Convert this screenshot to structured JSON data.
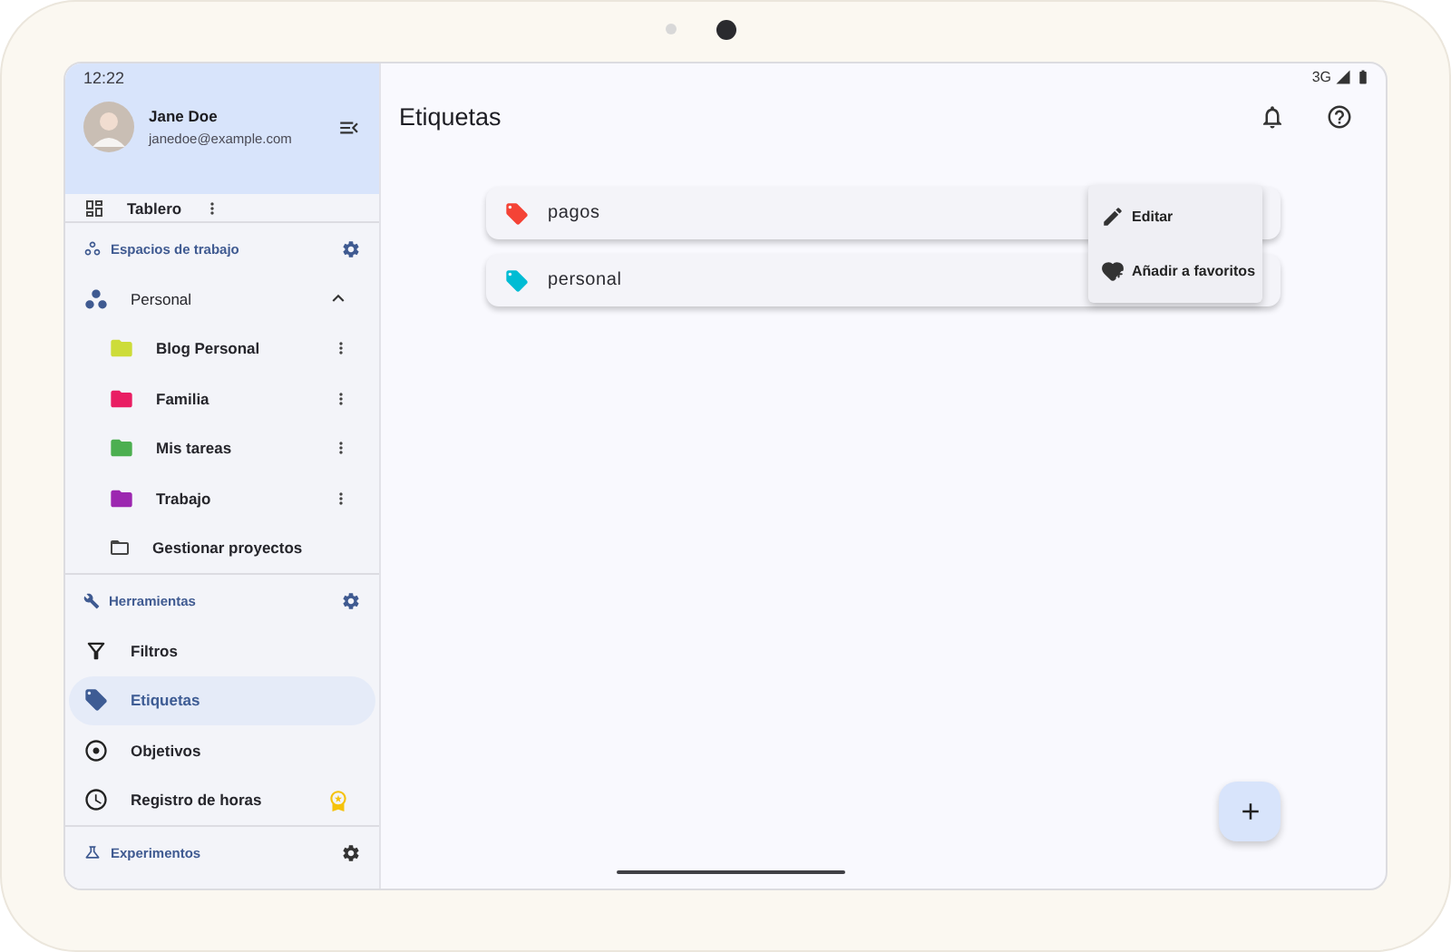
{
  "status_bar": {
    "time": "12:22",
    "network": "3G"
  },
  "profile": {
    "name": "Jane Doe",
    "email": "janedoe@example.com"
  },
  "sidebar": {
    "partial_item": {
      "label": "Tablero"
    },
    "workspaces": {
      "title": "Espacios de trabajo",
      "group": {
        "label": "Personal",
        "expanded": true,
        "children": [
          {
            "label": "Blog Personal",
            "kind": "project",
            "color": "#cddc39"
          },
          {
            "label": "Familia",
            "kind": "project",
            "color": "#e91e63"
          },
          {
            "label": "Mis tareas",
            "kind": "project",
            "color": "#4caf50"
          },
          {
            "label": "Trabajo",
            "kind": "project",
            "color": "#9c27b0"
          },
          {
            "label": "Gestionar proyectos",
            "kind": "manage"
          }
        ]
      }
    },
    "tools": {
      "title": "Herramientas",
      "items": [
        {
          "label": "Filtros",
          "kind": "filter",
          "selected": false,
          "premium": false
        },
        {
          "label": "Etiquetas",
          "kind": "tag",
          "selected": true,
          "premium": false
        },
        {
          "label": "Objetivos",
          "kind": "target",
          "selected": false,
          "premium": false
        },
        {
          "label": "Registro de horas",
          "kind": "clock",
          "selected": false,
          "premium": true
        }
      ]
    },
    "experiments": {
      "title": "Experimentos"
    }
  },
  "page": {
    "title": "Etiquetas"
  },
  "labels": [
    {
      "name": "pagos",
      "color": "#f44336"
    },
    {
      "name": "personal",
      "color": "#00bcd4"
    }
  ],
  "context_menu": [
    {
      "label": "Editar",
      "kind": "edit"
    },
    {
      "label": "Añadir a favoritos",
      "kind": "favorite"
    }
  ]
}
